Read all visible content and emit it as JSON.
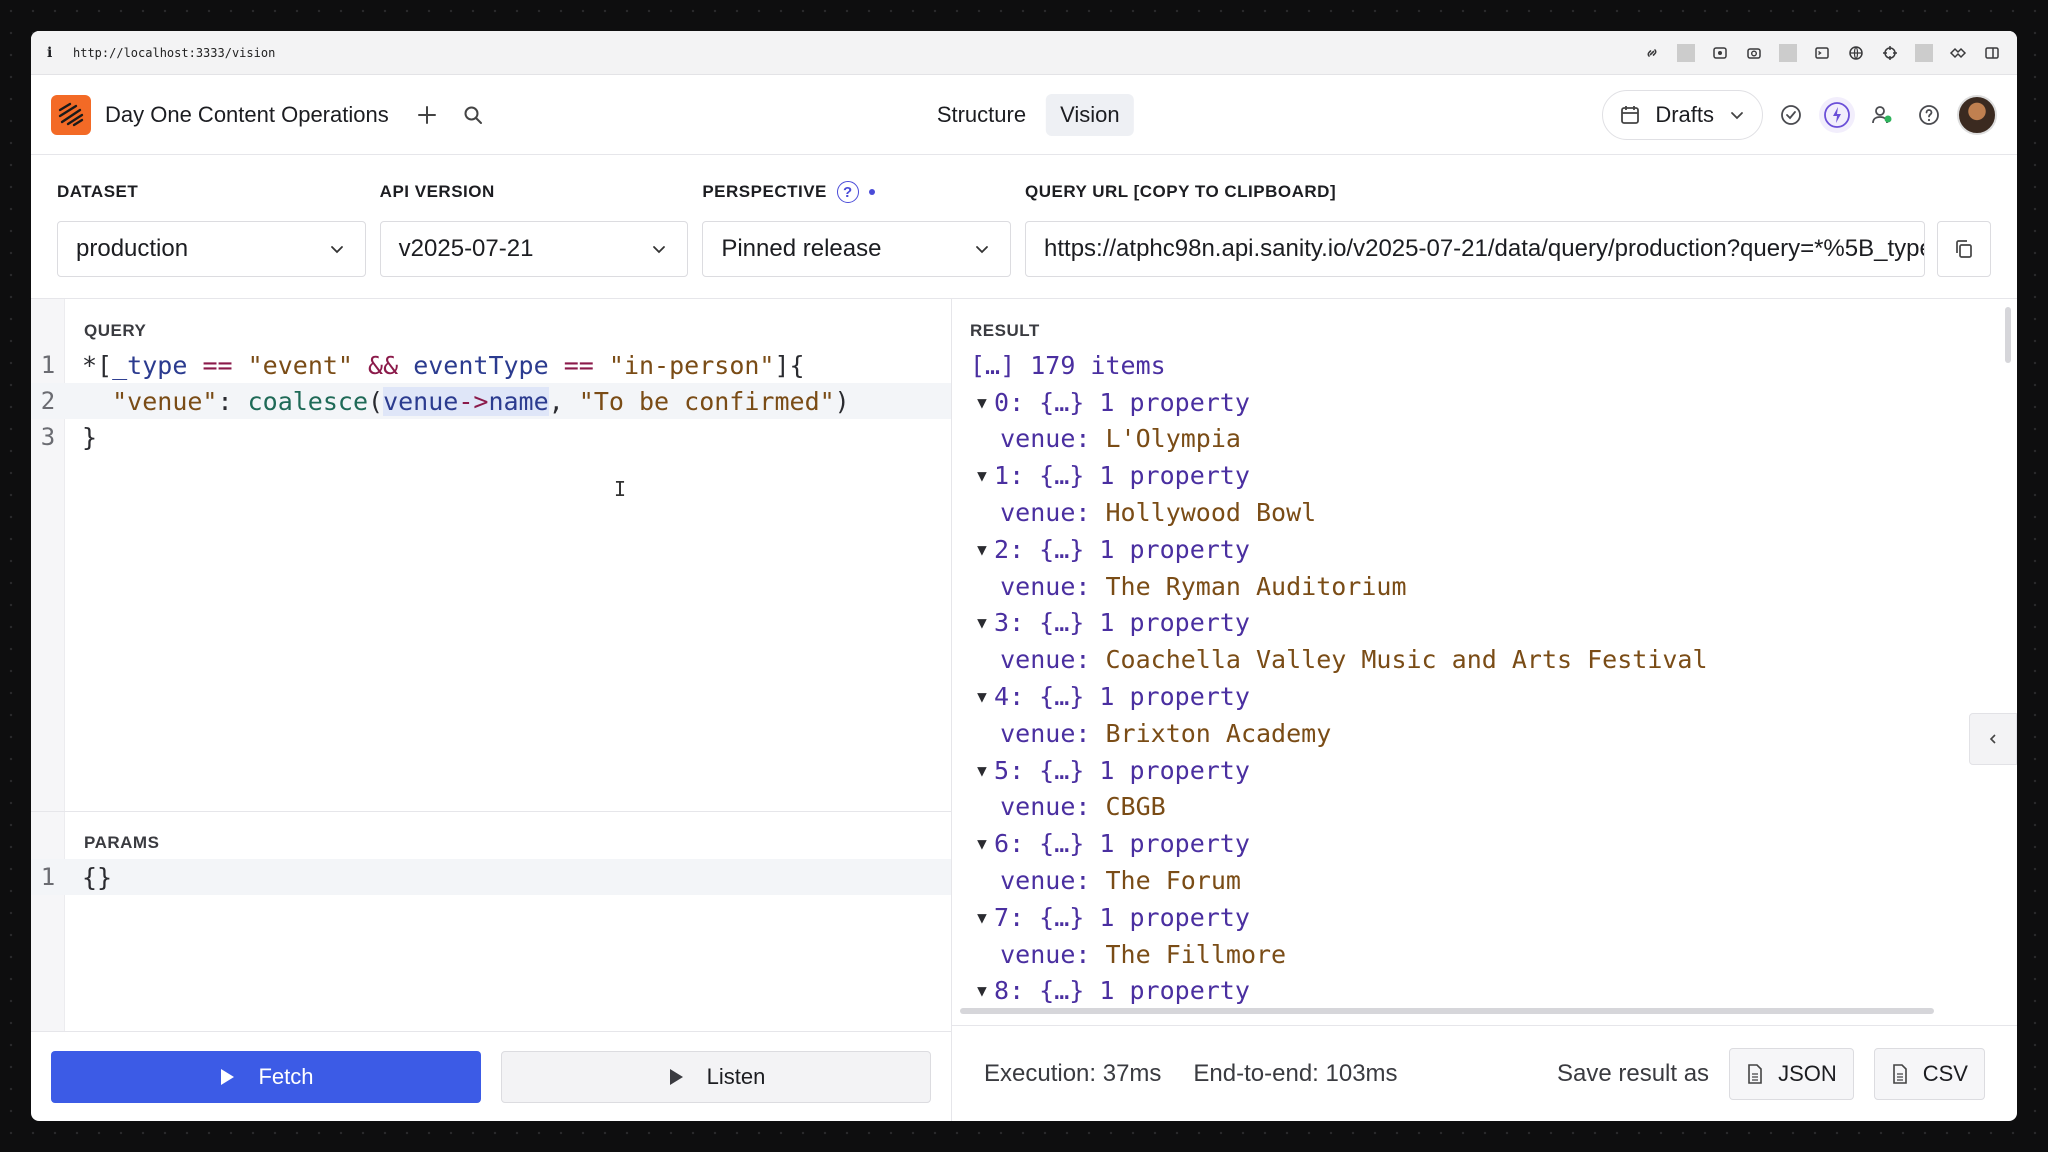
{
  "browser": {
    "info_glyph": "i",
    "url": "http://localhost:3333/vision"
  },
  "navbar": {
    "project_title": "Day One Content Operations",
    "tools": [
      "Structure",
      "Vision"
    ],
    "active_tool": "Vision",
    "perspective_menu": "Drafts"
  },
  "settings": {
    "dataset_label": "DATASET",
    "dataset_value": "production",
    "api_label": "API VERSION",
    "api_value": "v2025-07-21",
    "perspective_label": "PERSPECTIVE",
    "perspective_value": "Pinned release",
    "help_glyph": "?",
    "query_url_label": "QUERY URL [COPY TO CLIPBOARD]",
    "query_url_value": "https://atphc98n.api.sanity.io/v2025-07-21/data/query/production?query=*%5B_type"
  },
  "query": {
    "label": "QUERY",
    "line_numbers": [
      "1",
      "2",
      "3"
    ],
    "cursor_glyph": "I"
  },
  "params": {
    "label": "PARAMS",
    "line_numbers": [
      "1"
    ],
    "value": "{}"
  },
  "actions": {
    "fetch": "Fetch",
    "listen": "Listen"
  },
  "result": {
    "label": "RESULT",
    "summary_bracket": "[…]",
    "summary_count": "179 items",
    "items": [
      {
        "index": "0",
        "venue": "L'Olympia"
      },
      {
        "index": "1",
        "venue": "Hollywood Bowl"
      },
      {
        "index": "2",
        "venue": "The Ryman Auditorium"
      },
      {
        "index": "3",
        "venue": "Coachella Valley Music and Arts Festival"
      },
      {
        "index": "4",
        "venue": "Brixton Academy"
      },
      {
        "index": "5",
        "venue": "CBGB"
      },
      {
        "index": "6",
        "venue": "The Forum"
      },
      {
        "index": "7",
        "venue": "The Fillmore"
      },
      {
        "index": "8",
        "venue": ""
      }
    ],
    "object_preview": "{…}",
    "property_count": "1 property",
    "venue_key": "venue:"
  },
  "footer": {
    "execution": "Execution: 37ms",
    "end_to_end": "End-to-end: 103ms",
    "save_as": "Save result as",
    "json": "JSON",
    "csv": "CSV"
  },
  "colors": {
    "accent": "#3c5be6",
    "logo": "#f36a26",
    "string": "#7a4c16",
    "keyword": "#8b1a4a",
    "key": "#4a2fa0"
  }
}
